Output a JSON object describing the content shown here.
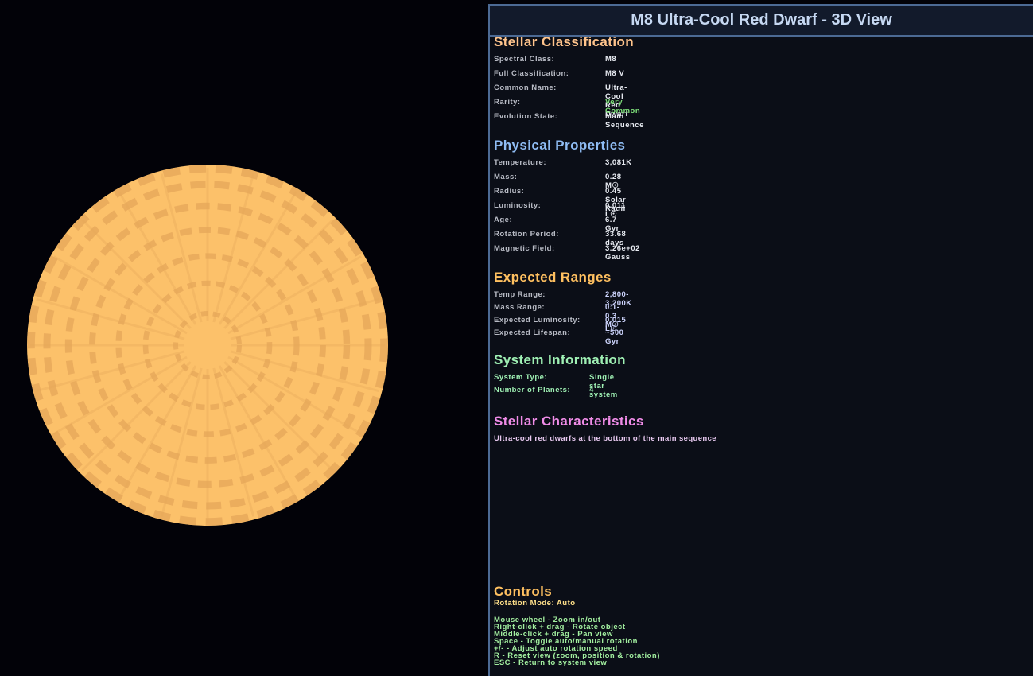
{
  "window_title": "M8 Ultra-Cool Red Dwarf - 3D View",
  "colors": {
    "star_base": "#fcc16a",
    "star_shade": "#e6a85a",
    "panel_border": "#4c6a94",
    "classification_title": "#ffc48c",
    "physical_title": "#8fbcf4",
    "ranges_title": "#ffc060",
    "system_title": "#9ff0b4",
    "characteristics_title": "#f08ce8",
    "controls_title": "#ffc060"
  },
  "classification": {
    "title": "Stellar Classification",
    "rows": [
      {
        "label": "Spectral Class:",
        "value": "M8"
      },
      {
        "label": "Full Classification:",
        "value": "M8 V"
      },
      {
        "label": "Common Name:",
        "value": "Ultra-Cool Red Dwarf"
      },
      {
        "label": "Rarity:",
        "value": "Very Common"
      },
      {
        "label": "Evolution State:",
        "value": "Main Sequence"
      }
    ]
  },
  "physical": {
    "title": "Physical Properties",
    "rows": [
      {
        "label": "Temperature:",
        "value": "3,081K"
      },
      {
        "label": "Mass:",
        "value": "0.28 M☉"
      },
      {
        "label": "Radius:",
        "value": "0.45 Solar Radii"
      },
      {
        "label": "Luminosity:",
        "value": "0.011 L☉"
      },
      {
        "label": "Age:",
        "value": "6.7 Gyr"
      },
      {
        "label": "Rotation Period:",
        "value": "33.68 days"
      },
      {
        "label": "Magnetic Field:",
        "value": "3.26e+02 Gauss"
      }
    ]
  },
  "ranges": {
    "title": "Expected Ranges",
    "rows": [
      {
        "label": "Temp Range:",
        "value": "2,800-3,200K"
      },
      {
        "label": "Mass Range:",
        "value": "0.1-0.3 M☉"
      },
      {
        "label": "Expected Luminosity:",
        "value": "0.015 L☉"
      },
      {
        "label": "Expected Lifespan:",
        "value": "~500 Gyr"
      }
    ]
  },
  "system": {
    "title": "System Information",
    "rows": [
      {
        "label": "System Type:",
        "value": "Single star system"
      },
      {
        "label": "Number of Planets:",
        "value": "4"
      }
    ]
  },
  "characteristics": {
    "title": "Stellar Characteristics",
    "description": "Ultra-cool red dwarfs at the bottom of the main sequence"
  },
  "controls": {
    "title": "Controls",
    "rotation_mode": "Rotation Mode: Auto",
    "items": [
      "Mouse wheel - Zoom in/out",
      "Right-click + drag - Rotate object",
      "Middle-click + drag - Pan view",
      "Space - Toggle auto/manual rotation",
      "+/- - Adjust auto rotation speed",
      "R - Reset view (zoom, position & rotation)",
      "ESC - Return to system view"
    ]
  }
}
